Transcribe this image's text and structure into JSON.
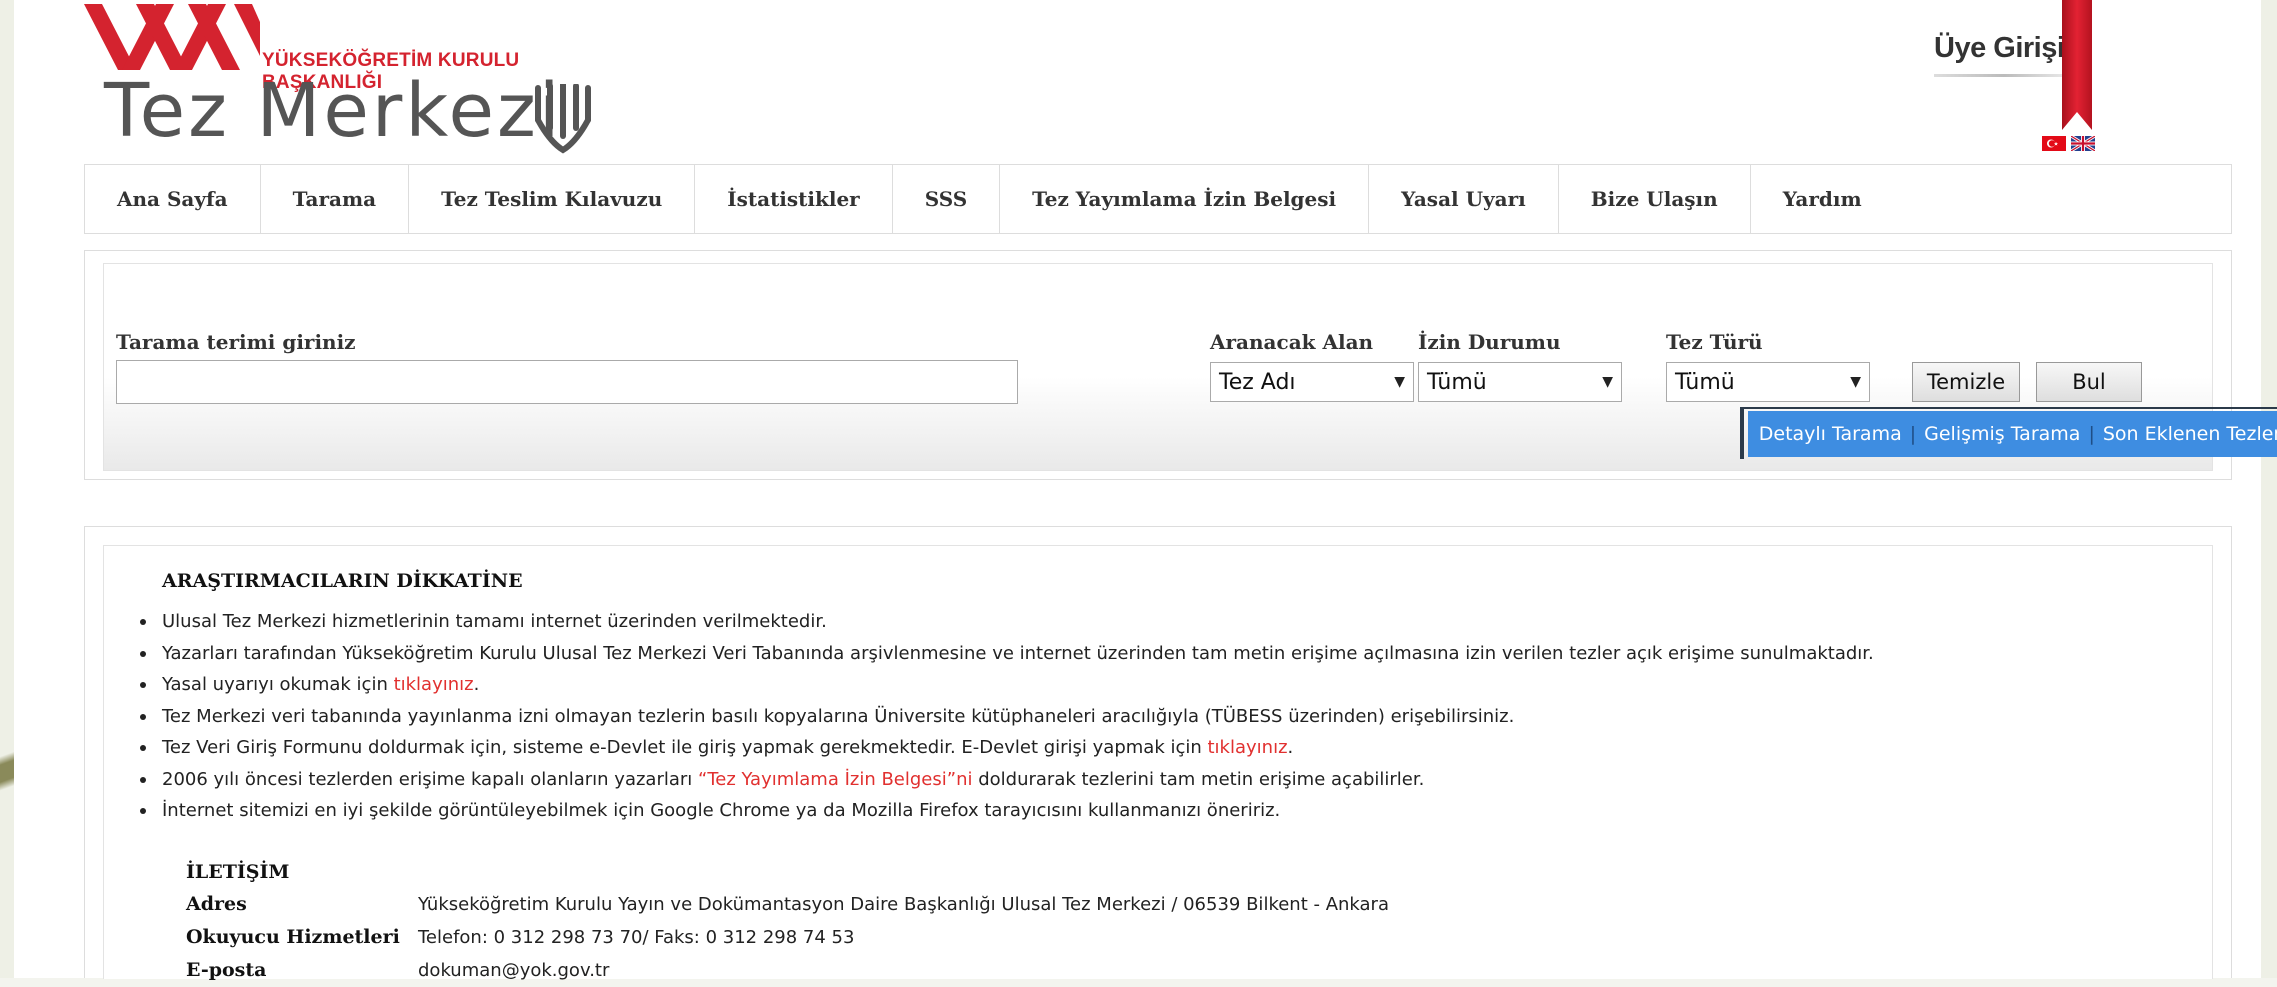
{
  "header": {
    "org_name": "YÜKSEKÖĞRETİM KURULU BAŞKANLIĞI",
    "brand_title": "Tez Merkezi",
    "member_login": "Üye Girişi",
    "languages": [
      "turkish-flag-icon",
      "english-flag-icon"
    ],
    "colors": {
      "brand_red": "#d4232f",
      "link_blue": "#3e8de1"
    }
  },
  "nav": {
    "items": [
      {
        "label": "Ana Sayfa"
      },
      {
        "label": "Tarama"
      },
      {
        "label": "Tez Teslim Kılavuzu"
      },
      {
        "label": "İstatistikler"
      },
      {
        "label": "SSS"
      },
      {
        "label": "Tez Yayımlama İzin Belgesi"
      },
      {
        "label": "Yasal Uyarı"
      },
      {
        "label": "Bize Ulaşın"
      },
      {
        "label": "Yardım"
      }
    ]
  },
  "search": {
    "term_label": "Tarama terimi giriniz",
    "term_value": "",
    "field_label": "Aranacak Alan",
    "field_value": "Tez Adı",
    "permission_label": "İzin Durumu",
    "permission_value": "Tümü",
    "type_label": "Tez Türü",
    "type_value": "Tümü",
    "clear_label": "Temizle",
    "find_label": "Bul",
    "links": [
      "Detaylı Tarama",
      "Gelişmiş Tarama",
      "Son Eklenen Tezler"
    ],
    "separator": "|"
  },
  "notice": {
    "title": "ARAŞTIRMACILARIN DİKKATİNE",
    "b1": "Ulusal Tez Merkezi hizmetlerinin tamamı internet üzerinden verilmektedir.",
    "b2": "Yazarları tarafından Yükseköğretim Kurulu Ulusal Tez Merkezi Veri Tabanında arşivlenmesine ve internet üzerinden tam metin erişime açılmasına izin verilen tezler açık erişime sunulmaktadır.",
    "b3_pre": "Yasal uyarıyı okumak için ",
    "b3_link": "tıklayınız",
    "b3_post": ".",
    "b4": "Tez Merkezi veri tabanında yayınlanma izni olmayan tezlerin basılı kopyalarına Üniversite kütüphaneleri aracılığıyla (TÜBESS üzerinden) erişebilirsiniz.",
    "b5_pre": "Tez Veri Giriş Formunu doldurmak için, sisteme e-Devlet ile giriş yapmak gerekmektedir. E-Devlet girişi yapmak için ",
    "b5_link": "tıklayınız",
    "b5_post": ".",
    "b6_pre": "2006 yılı öncesi tezlerden erişime kapalı olanların yazarları ",
    "b6_link": "“Tez Yayımlama İzin Belgesi”ni",
    "b6_post": " doldurarak tezlerini tam metin erişime açabilirler.",
    "b7": "İnternet sitemizi en iyi şekilde görüntüleyebilmek için Google Chrome ya da Mozilla Firefox tarayıcısını kullanmanızı öneririz."
  },
  "contact": {
    "title": "İLETİŞİM",
    "address_key": "Adres",
    "address_value": "Yükseköğretim Kurulu Yayın ve Dokümantasyon Daire Başkanlığı Ulusal Tez Merkezi / 06539 Bilkent - Ankara",
    "reader_key": "Okuyucu Hizmetleri",
    "reader_value": "Telefon: 0 312 298 73 70/ Faks: 0 312 298 74 53",
    "email_key": "E-posta",
    "email_value": "dokuman@yok.gov.tr"
  }
}
